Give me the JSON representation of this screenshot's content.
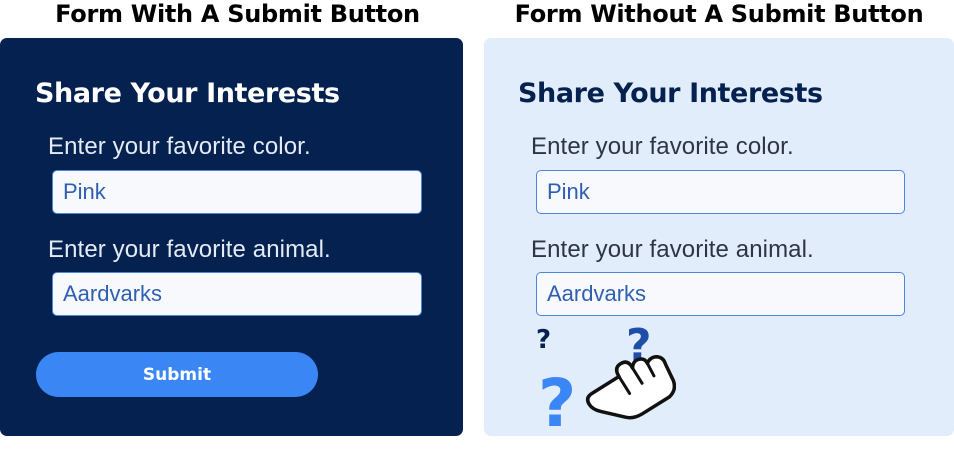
{
  "left": {
    "heading": "Form With A Submit Button",
    "form_title": "Share Your Interests",
    "color_label": "Enter your favorite color.",
    "color_value": "Pink",
    "animal_label": "Enter your favorite animal.",
    "animal_value": "Aardvarks",
    "submit_label": "Submit"
  },
  "right": {
    "heading": "Form Without A Submit Button",
    "form_title": "Share Your Interests",
    "color_label": "Enter your favorite color.",
    "color_value": "Pink",
    "animal_label": "Enter your favorite animal.",
    "animal_value": "Aardvarks",
    "confusion_icons": [
      "question-mark-icon",
      "question-mark-icon",
      "question-mark-icon",
      "pointing-hand-cursor-icon"
    ]
  },
  "colors": {
    "dark_panel": "#05214f",
    "light_panel": "#e2edfc",
    "accent_blue": "#3a86f4",
    "input_border": "#4f84dd",
    "input_text": "#2f5fb0"
  }
}
